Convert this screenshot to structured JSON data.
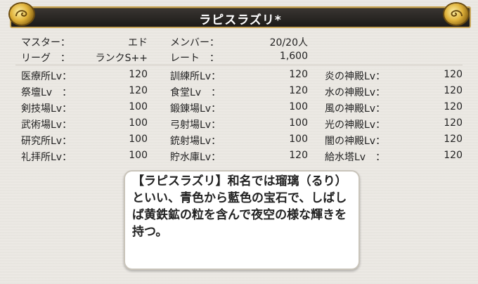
{
  "title": "ラピスラズリ*",
  "guild": {
    "master_label": "マスター：",
    "master_value": "エド",
    "members_label": "メンバー：",
    "members_value": "20/20人",
    "league_label": "リーグ　：",
    "league_value": "ランクS++",
    "rate_label": "レート　：",
    "rate_value": "1,600"
  },
  "facilities": {
    "col1": [
      {
        "label": "医療所Lv：",
        "value": "120"
      },
      {
        "label": "祭壇Lv　：",
        "value": "120"
      },
      {
        "label": "剣技場Lv：",
        "value": "100"
      },
      {
        "label": "武術場Lv：",
        "value": "100"
      },
      {
        "label": "研究所Lv：",
        "value": "100"
      },
      {
        "label": "礼拝所Lv：",
        "value": "100"
      }
    ],
    "col2": [
      {
        "label": "訓練所Lv：",
        "value": "120"
      },
      {
        "label": "食堂Lv　：",
        "value": "120"
      },
      {
        "label": "鍛錬場Lv：",
        "value": "100"
      },
      {
        "label": "弓射場Lv：",
        "value": "100"
      },
      {
        "label": "銃射場Lv：",
        "value": "100"
      },
      {
        "label": "貯水庫Lv：",
        "value": "120"
      }
    ],
    "col3": [
      {
        "label": "炎の神殿Lv：",
        "value": "120"
      },
      {
        "label": "水の神殿Lv：",
        "value": "120"
      },
      {
        "label": "風の神殿Lv：",
        "value": "120"
      },
      {
        "label": "光の神殿Lv：",
        "value": "120"
      },
      {
        "label": "闇の神殿Lv：",
        "value": "120"
      },
      {
        "label": "給水塔Lv　：",
        "value": "120"
      }
    ]
  },
  "description": "【ラピスラズリ】和名では瑠璃（るり）といい、青色から藍色の宝石で、しばしば黄鉄鉱の粒を含んで夜空の様な輝きを持つ。"
}
